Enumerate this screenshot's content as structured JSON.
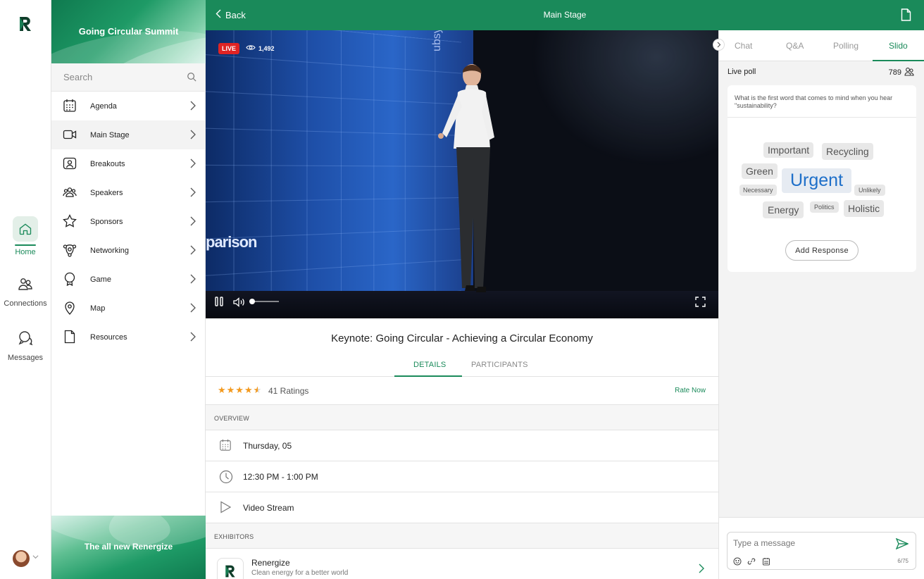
{
  "rail": {
    "items": [
      {
        "label": "Home",
        "icon": "home-icon",
        "active": true
      },
      {
        "label": "Connections",
        "icon": "connections-icon",
        "active": false
      },
      {
        "label": "Messages",
        "icon": "messages-icon",
        "active": false
      }
    ]
  },
  "nav": {
    "banner_title": "Going Circular Summit",
    "search_placeholder": "Search",
    "items": [
      {
        "label": "Agenda",
        "icon": "calendar-icon"
      },
      {
        "label": "Main Stage",
        "icon": "video-camera-icon",
        "active": true
      },
      {
        "label": "Breakouts",
        "icon": "breakouts-icon"
      },
      {
        "label": "Speakers",
        "icon": "speakers-icon"
      },
      {
        "label": "Sponsors",
        "icon": "star-icon"
      },
      {
        "label": "Networking",
        "icon": "networking-icon"
      },
      {
        "label": "Game",
        "icon": "award-icon"
      },
      {
        "label": "Map",
        "icon": "map-pin-icon"
      },
      {
        "label": "Resources",
        "icon": "document-icon"
      }
    ],
    "footer_title": "The all new Renergize"
  },
  "header": {
    "back_label": "Back",
    "title": "Main Stage"
  },
  "video": {
    "live_label": "LIVE",
    "viewers": "1,492",
    "screen_text": "parison",
    "screen_vertical_text": "ubsystem",
    "volume_level": 0.05
  },
  "session": {
    "title": "Keynote: Going Circular - Achieving a Circular Economy",
    "tabs": [
      "DETAILS",
      "PARTICIPANTS"
    ],
    "active_tab": "DETAILS",
    "rating_stars": 4.5,
    "ratings_count": "41 Ratings",
    "rate_now": "Rate Now",
    "overview_label": "OVERVIEW",
    "date": "Thursday, 05",
    "time": "12:30 PM - 1:00 PM",
    "stream": "Video Stream",
    "exhibitors_label": "EXHIBITORS",
    "exhibitor": {
      "name": "Renergize",
      "description": "Clean energy for a better world"
    }
  },
  "right_panel": {
    "tabs": [
      "Chat",
      "Q&A",
      "Polling",
      "Slido"
    ],
    "active_tab": "Slido",
    "live_poll_label": "Live poll",
    "poll_count": "789",
    "question": "What is the first word that comes to mind when you hear \"sustainability?",
    "words": [
      "Important",
      "Recycling",
      "Green",
      "Urgent",
      "Necessary",
      "Unlikely",
      "Energy",
      "Politics",
      "Holistic"
    ],
    "add_response": "Add Response",
    "composer_placeholder": "Type a message",
    "char_limit": "6/75"
  },
  "colors": {
    "brand_green": "#1a8a5a",
    "live_red": "#e02424",
    "star_orange": "#f39a1f",
    "urgent_blue": "#1e6fc9"
  }
}
